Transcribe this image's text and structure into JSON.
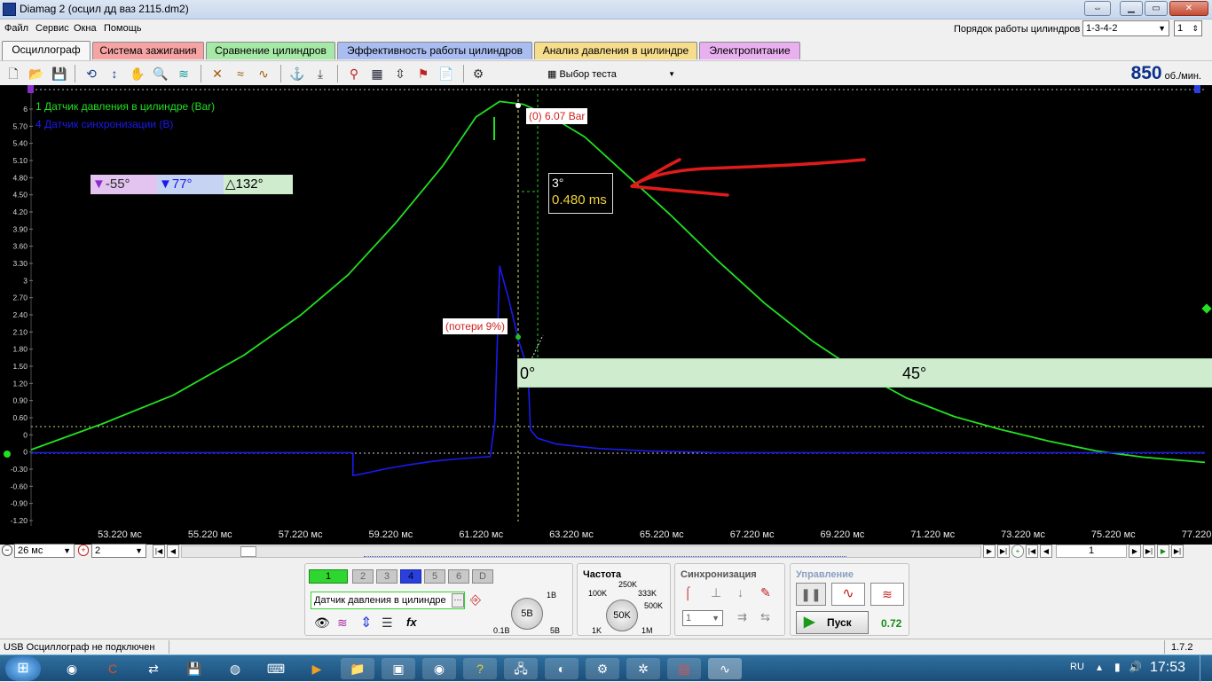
{
  "window": {
    "title": "Diamag 2 (осцил дд ваз 2115.dm2)"
  },
  "menu": [
    "Файл",
    "Сервис",
    "Окна",
    "Помощь"
  ],
  "firing_order": {
    "label": "Порядок работы цилиндров",
    "value": "1-3-4-2",
    "cylinder": "1"
  },
  "tabs": [
    {
      "label": "Осциллограф",
      "color": "#f0f0f0"
    },
    {
      "label": "Система зажигания",
      "color": "#f6a3a3"
    },
    {
      "label": "Сравнение цилиндров",
      "color": "#a6e8a6"
    },
    {
      "label": "Эффективность работы цилиндров",
      "color": "#a9bdf0"
    },
    {
      "label": "Анализ давления в цилиндре",
      "color": "#f6dd8c"
    },
    {
      "label": "Электропитание",
      "color": "#e9b0ef"
    }
  ],
  "toolbar": {
    "test_select": "Выбор теста"
  },
  "rpm": {
    "value": "850",
    "unit": "об./мин."
  },
  "legend": [
    {
      "label": "1 Датчик давления в цилиндре (Bar)",
      "color": "#22e022"
    },
    {
      "label": "4 Датчик синхронизации (В)",
      "color": "#1a1aee"
    }
  ],
  "angles": {
    "a": "-55°",
    "b": "77°",
    "delta": "132°"
  },
  "cursor": {
    "peak": "(0) 6.07 Bar",
    "deg": "3°",
    "ms": "0.480 ms"
  },
  "losses": "(потери 9%)",
  "degree_band": {
    "start": "0°",
    "mark": "45°"
  },
  "chart_data": {
    "type": "line",
    "xlabel": "",
    "ylabel": "",
    "x_ticks": [
      "53.220 мс",
      "55.220 мс",
      "57.220 мс",
      "59.220 мс",
      "61.220 мс",
      "63.220 мс",
      "65.220 мс",
      "67.220 мс",
      "69.220 мс",
      "71.220 мс",
      "73.220 мс",
      "75.220 мс",
      "77.220 мс"
    ],
    "y_ticks": [
      "6",
      "5.70",
      "5.40",
      "5.10",
      "4.80",
      "4.50",
      "4.20",
      "3.90",
      "3.60",
      "3.30",
      "3",
      "2.70",
      "2.40",
      "2.10",
      "1.80",
      "1.50",
      "1.20",
      "0.90",
      "0.60",
      "0",
      "0",
      "-0.30",
      "-0.60",
      "-0.90",
      "-1.20"
    ],
    "xlim": [
      52.5,
      77.3
    ],
    "ylim": [
      -1.25,
      6.2
    ],
    "series": [
      {
        "name": "1 Датчик давления в цилиндре (Bar)",
        "color": "#22e022",
        "x": [
          52.5,
          54.0,
          55.5,
          57.0,
          58.2,
          59.2,
          60.2,
          61.2,
          61.9,
          62.4,
          62.9,
          63.5,
          64.2,
          65.0,
          66.0,
          67.0,
          68.0,
          69.0,
          70.0,
          71.0,
          72.0,
          73.0,
          74.0,
          75.0,
          76.0,
          77.3
        ],
        "y": [
          0.0,
          0.45,
          0.95,
          1.65,
          2.35,
          3.05,
          3.95,
          4.95,
          5.8,
          6.07,
          6.02,
          5.8,
          5.45,
          4.85,
          4.1,
          3.3,
          2.55,
          1.9,
          1.35,
          0.9,
          0.58,
          0.35,
          0.15,
          -0.02,
          -0.13,
          -0.22
        ]
      },
      {
        "name": "4 Датчик синхронизации (В)",
        "color": "#1a1aee",
        "x": [
          52.5,
          59.3,
          59.3,
          59.5,
          60.0,
          60.5,
          61.0,
          61.5,
          62.0,
          62.2,
          62.3,
          62.4,
          62.6,
          62.8,
          63.0,
          63.05,
          63.2,
          63.6,
          64.5,
          65.5,
          67.0,
          69.0,
          77.3
        ],
        "y": [
          -0.05,
          -0.05,
          -0.45,
          -0.42,
          -0.33,
          -0.26,
          -0.2,
          -0.16,
          -0.13,
          -0.12,
          0.5,
          3.2,
          2.6,
          1.9,
          1.4,
          0.35,
          0.2,
          0.1,
          0.02,
          -0.02,
          -0.05,
          -0.05,
          -0.05
        ]
      }
    ]
  },
  "bottom": {
    "timebase": "26 мс",
    "zoom": "2",
    "page": "1"
  },
  "panel": {
    "channels": [
      "1",
      "2",
      "3",
      "4",
      "5",
      "6",
      "D"
    ],
    "sensor": "Датчик давления в цилиндре",
    "knob_volt": {
      "value": "5В",
      "min": "0.1В",
      "max": "5В",
      "top": "1В"
    },
    "freq": {
      "title": "Частота",
      "value": "50K",
      "l1": "100K",
      "l2": "250K",
      "l3": "333K",
      "l4": "500K",
      "l5": "1K",
      "l6": "1M"
    },
    "sync": {
      "title": "Синхронизация",
      "value": "1"
    },
    "control": {
      "title": "Управление",
      "start": "Пуск",
      "value": "0.72"
    }
  },
  "status": {
    "text": "USB Осциллограф не подключен",
    "version": "1.7.2"
  },
  "taskbar": {
    "lang": "RU",
    "time": "17:53"
  }
}
